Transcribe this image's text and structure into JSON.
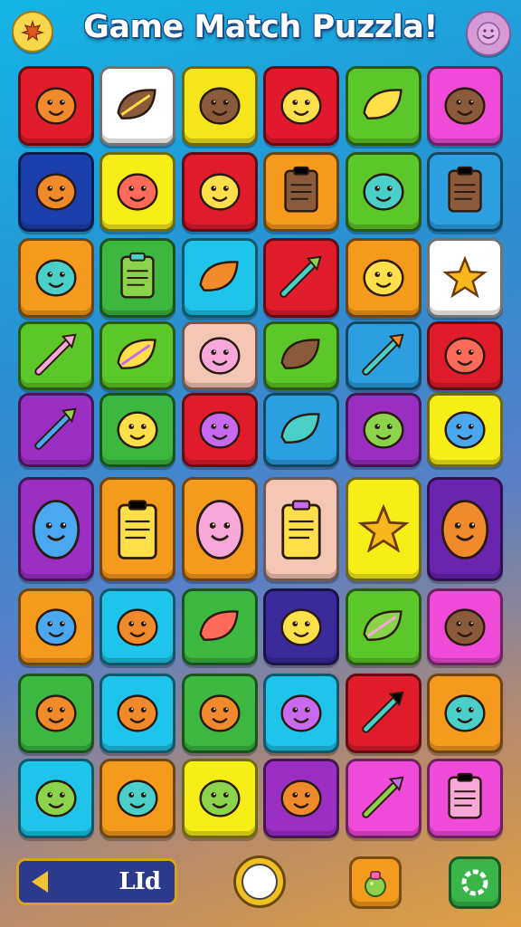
{
  "header": {
    "title": "Game Match Puzzla!",
    "left_icon": "maple-leaf-icon",
    "right_icon": "smiley-face-icon"
  },
  "footer": {
    "level_label": "LId",
    "back_icon": "arrow-left-icon",
    "center_icon": "circle-button-icon",
    "item_icon": "potion-icon",
    "settings_icon": "ring-icon"
  },
  "board": {
    "rows": [
      [
        {
          "color": "#e21d2b",
          "icon": "pink-monster-icon"
        },
        {
          "color": "#ffffff",
          "icon": "leaf-icon"
        },
        {
          "color": "#f6e51a",
          "icon": "yellow-drop-icon"
        },
        {
          "color": "#e2182c",
          "icon": "blue-alien-icon"
        },
        {
          "color": "#5cc728",
          "icon": "orange-leaf-icon"
        },
        {
          "color": "#f04ad8",
          "icon": "sun-face-icon"
        }
      ],
      [
        {
          "color": "#1c3fae",
          "icon": "pink-pig-icon"
        },
        {
          "color": "#f7ee18",
          "icon": "heart-icon"
        },
        {
          "color": "#e01c2a",
          "icon": "spiral-shell-icon"
        },
        {
          "color": "#f69a1e",
          "icon": "pink-vest-icon"
        },
        {
          "color": "#5cc728",
          "icon": "bird-icon"
        },
        {
          "color": "#2b9fe0",
          "icon": "card-icon"
        }
      ],
      [
        {
          "color": "#f69a1e",
          "icon": "blue-blob-icon"
        },
        {
          "color": "#3cb840",
          "icon": "pink-block-icon"
        },
        {
          "color": "#1ec4ea",
          "icon": "shield-icon"
        },
        {
          "color": "#e01c2a",
          "icon": "crayon-icon"
        },
        {
          "color": "#f69a1e",
          "icon": "ufo-icon"
        },
        {
          "color": "#ffffff",
          "icon": "star-icon"
        }
      ],
      [
        {
          "color": "#5cc728",
          "icon": "arrow-icon"
        },
        {
          "color": "#5cc728",
          "icon": "pink-fish-icon"
        },
        {
          "color": "#f6c6b4",
          "icon": "yellow-splat-icon"
        },
        {
          "color": "#5cc728",
          "icon": "blue-leaf-icon"
        },
        {
          "color": "#2b9fe0",
          "icon": "paint-tube-icon"
        },
        {
          "color": "#e01c2a",
          "icon": "red-apple-icon"
        }
      ],
      [
        {
          "color": "#9b2fc4",
          "icon": "lightning-icon"
        },
        {
          "color": "#3cb840",
          "icon": "mushroom-key-icon"
        },
        {
          "color": "#e01c2a",
          "icon": "bear-face-icon"
        },
        {
          "color": "#2b9fe0",
          "icon": "banana-fish-icon"
        },
        {
          "color": "#9b2fc4",
          "icon": "cat-face-icon"
        },
        {
          "color": "#f7ee18",
          "icon": "speech-bubble-icon"
        }
      ],
      [
        {
          "color": "#9b2fc4",
          "icon": "pink-bear-icon"
        },
        {
          "color": "#f69a1e",
          "icon": "clipboard-icon"
        },
        {
          "color": "#f69a1e",
          "icon": "brown-bear-icon"
        },
        {
          "color": "#f6c6b4",
          "icon": "robot-tag-icon"
        },
        {
          "color": "#f7ee18",
          "icon": "star-clipboard-icon"
        },
        {
          "color": "#6b24b0",
          "icon": "yellow-creature-icon"
        }
      ],
      [
        {
          "color": "#f69a1e",
          "icon": "orange-smiley-icon"
        },
        {
          "color": "#1ec4ea",
          "icon": "grin-face-icon"
        },
        {
          "color": "#3cb840",
          "icon": "purple-leaf-icon"
        },
        {
          "color": "#3a2a9c",
          "icon": "orange-sun-icon"
        },
        {
          "color": "#5cc728",
          "icon": "pink-leaf-icon"
        },
        {
          "color": "#f04ad8",
          "icon": "green-frog-icon"
        }
      ],
      [
        {
          "color": "#3cb840",
          "icon": "yellow-smiley-icon"
        },
        {
          "color": "#1ec4ea",
          "icon": "blue-mushroom-icon"
        },
        {
          "color": "#3cb840",
          "icon": "orange-ball-icon"
        },
        {
          "color": "#1ec4ea",
          "icon": "red-robot-icon"
        },
        {
          "color": "#e01c2a",
          "icon": "rocket-icon"
        },
        {
          "color": "#f69a1e",
          "icon": "orange-planet-icon"
        }
      ],
      [
        {
          "color": "#1ec4ea",
          "icon": "burger-icon"
        },
        {
          "color": "#f69a1e",
          "icon": "blue-bird-icon"
        },
        {
          "color": "#f7ee18",
          "icon": "orange-cat-icon"
        },
        {
          "color": "#9b2fc4",
          "icon": "green-ball-icon"
        },
        {
          "color": "#f04ad8",
          "icon": "magic-wand-icon"
        },
        {
          "color": "#f04ad8",
          "icon": "battery-icon"
        }
      ]
    ]
  }
}
